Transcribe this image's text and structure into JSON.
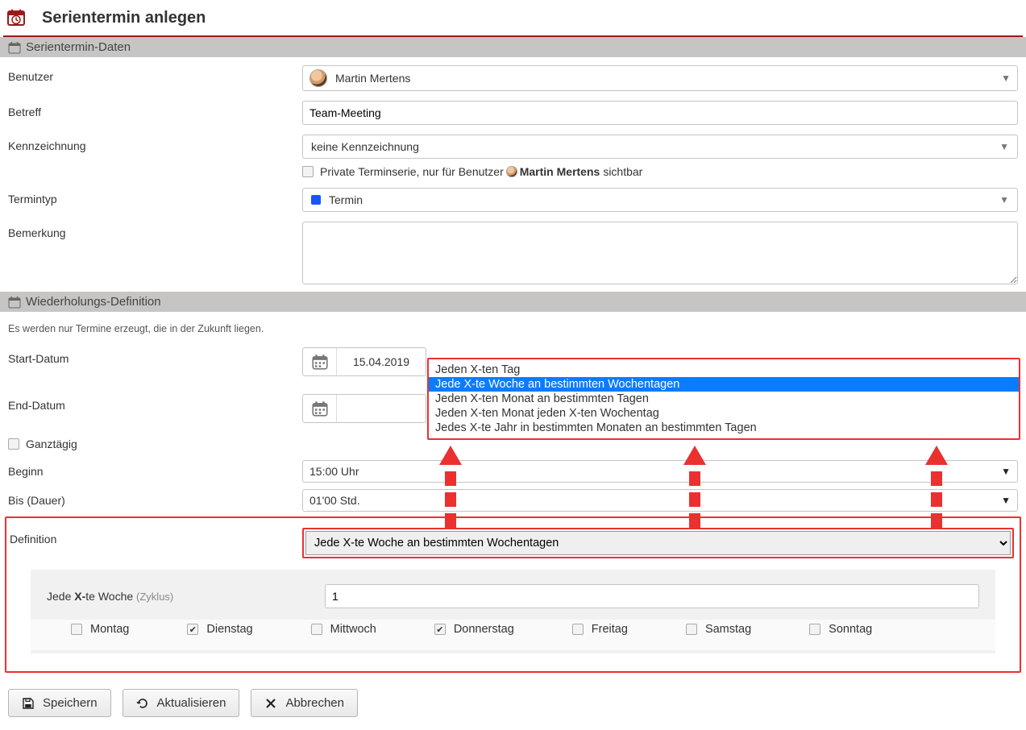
{
  "header": {
    "title": "Serientermin anlegen"
  },
  "section1": {
    "title": "Serientermin-Daten",
    "rows": {
      "user_label": "Benutzer",
      "user_value": "Martin Mertens",
      "subject_label": "Betreff",
      "subject_value": "Team-Meeting",
      "tagging_label": "Kennzeichnung",
      "tagging_value": "keine Kennzeichnung",
      "private_prefix": "Private Terminserie, nur für Benutzer",
      "private_name": "Martin Mertens",
      "private_suffix": "sichtbar",
      "type_label": "Termintyp",
      "type_value": "Termin",
      "remark_label": "Bemerkung",
      "remark_value": ""
    }
  },
  "section2": {
    "title": "Wiederholungs-Definition",
    "hint": "Es werden nur Termine erzeugt, die in der Zukunft liegen.",
    "start_label": "Start-Datum",
    "start_value": "15.04.2019",
    "end_label": "End-Datum",
    "end_value": "",
    "allday_label": "Ganztägig",
    "begin_label": "Beginn",
    "begin_value": "15:00 Uhr",
    "duration_label": "Bis (Dauer)",
    "duration_value": "01'00 Std.",
    "definition_label": "Definition",
    "definition_value": "Jede X-te Woche an bestimmten Wochentagen",
    "definition_options": [
      "Jeden X-ten Tag",
      "Jede X-te Woche an bestimmten Wochentagen",
      "Jeden X-ten Monat an bestimmten Tagen",
      "Jeden X-ten Monat jeden X-ten Wochentag",
      "Jedes X-te Jahr in bestimmten Monaten an bestimmten Tagen"
    ],
    "cycle_label_pre": "Jede ",
    "cycle_label_bold": "X-",
    "cycle_label_post": "te Woche ",
    "cycle_hint": "(Zyklus)",
    "cycle_value": "1",
    "days": [
      {
        "label": "Montag",
        "checked": false
      },
      {
        "label": "Dienstag",
        "checked": true
      },
      {
        "label": "Mittwoch",
        "checked": false
      },
      {
        "label": "Donnerstag",
        "checked": true
      },
      {
        "label": "Freitag",
        "checked": false
      },
      {
        "label": "Samstag",
        "checked": false
      },
      {
        "label": "Sonntag",
        "checked": false
      }
    ]
  },
  "footer": {
    "save": "Speichern",
    "refresh": "Aktualisieren",
    "cancel": "Abbrechen"
  }
}
